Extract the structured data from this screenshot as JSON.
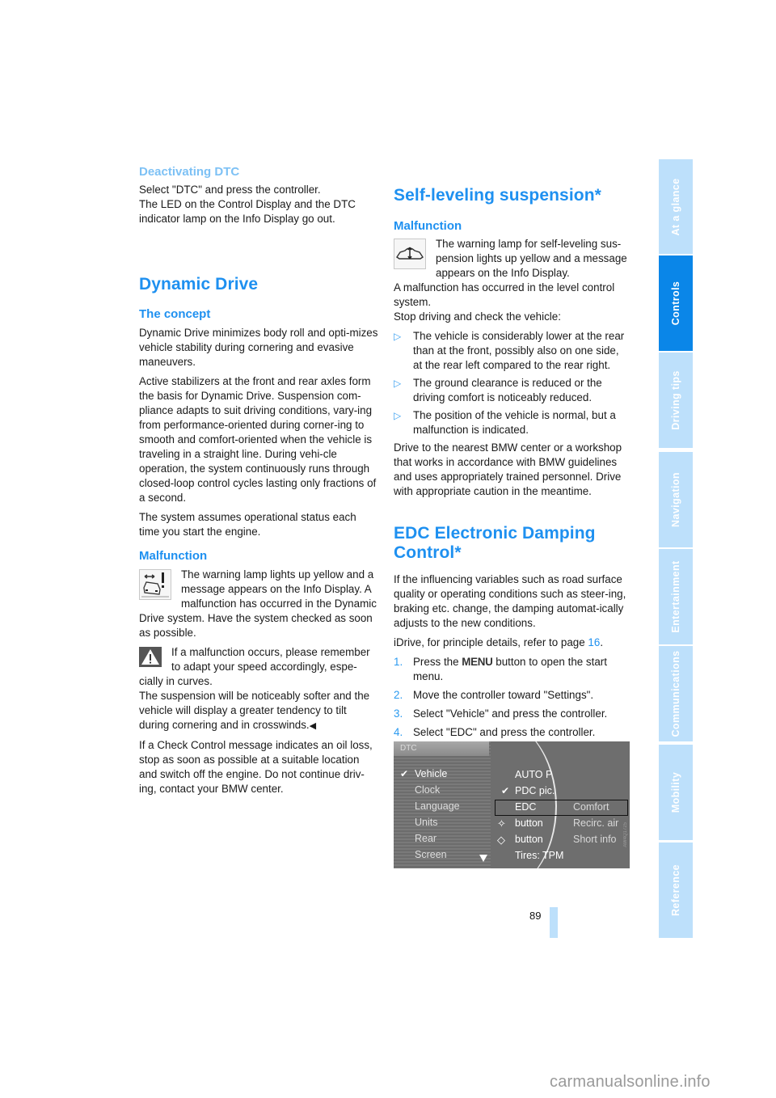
{
  "left_column": {
    "deactivating_dtc": {
      "heading": "Deactivating DTC",
      "text": "Select \"DTC\" and press the controller.\nThe LED on the Control Display and the DTC indicator lamp on the Info Display go out."
    },
    "dynamic_drive": {
      "title": "Dynamic Drive",
      "concept_heading": "The concept",
      "concept_paragraphs": [
        "Dynamic Drive minimizes body roll and opti-mizes vehicle stability during cornering and evasive maneuvers.",
        "Active stabilizers at the front and rear axles form the basis for Dynamic Drive. Suspension com-pliance adapts to suit driving conditions, vary-ing from performance-oriented during corner-ing to smooth and comfort-oriented when the vehicle is traveling in a straight line. During vehi-cle operation, the system continuously runs through closed-loop control cycles lasting only fractions of a second.",
        "The system assumes operational status each time you start the engine."
      ],
      "malfunction_heading": "Malfunction",
      "malfunction_icon": "dynamic-drive-warning-lamp-icon",
      "malfunction_text": "The warning lamp lights up yellow and a message appears on the Info Display. A malfunction has occurred in the Dynamic Drive system. Have the system checked as soon as possible.",
      "caution_icon": "warning-triangle-icon",
      "caution_text": "If a malfunction occurs, please remember to adapt your speed accordingly, espe-cially in curves.",
      "caution_text2": "The suspension will be noticeably softer and the vehicle will display a greater tendency to tilt during cornering and in crosswinds.",
      "end_mark": "◀",
      "oil_loss_text": "If a Check Control message indicates an oil loss, stop as soon as possible at a suitable location and switch off the engine. Do not continue driv-ing, contact your BMW center."
    }
  },
  "right_column": {
    "self_leveling": {
      "title": "Self-leveling suspension*",
      "malfunction_heading": "Malfunction",
      "lamp_icon": "self-leveling-warning-lamp-icon",
      "lamp_text": "The warning lamp for self-leveling sus-pension lights up yellow and a message appears on the Info Display.",
      "text2": "A malfunction has occurred in the level control system.",
      "text3": "Stop driving and check the vehicle:",
      "bullet_marker": "▷",
      "bullets": [
        "The vehicle is considerably lower at the rear than at the front, possibly also on one side, at the rear left compared to the rear right.",
        "The ground clearance is reduced or the driving comfort is noticeably reduced.",
        "The position of the vehicle is normal, but a malfunction is indicated."
      ],
      "closing": "Drive to the nearest BMW center or a workshop that works in accordance with BMW guidelines and uses appropriately trained personnel. Drive with appropriate caution in the meantime."
    },
    "edc": {
      "title": "EDC Electronic Damping Control*",
      "intro": "If the influencing variables such as road surface quality or operating conditions such as steer-ing, braking etc. change, the damping automat-ically adjusts to the new conditions.",
      "idrive_prefix": "iDrive, for principle details, refer to page ",
      "idrive_page": "16",
      "idrive_suffix": ".",
      "steps": [
        {
          "num": "1.",
          "pre": "Press the ",
          "key": "MENU",
          "post": " button to open the start menu."
        },
        {
          "num": "2.",
          "pre": "Move the controller toward \"Settings\".",
          "key": "",
          "post": ""
        },
        {
          "num": "3.",
          "pre": "Select \"Vehicle\" and press the controller.",
          "key": "",
          "post": ""
        },
        {
          "num": "4.",
          "pre": "Select \"EDC\" and press the controller.",
          "key": "",
          "post": ""
        }
      ]
    },
    "screen": {
      "header": "DTC",
      "left_menu": [
        "Vehicle",
        "Clock",
        "Language",
        "Units",
        "Rear",
        "Screen"
      ],
      "left_selected": "Vehicle",
      "right_menu": [
        {
          "label": "AUTO P",
          "value": ""
        },
        {
          "label": "PDC pic.",
          "value": "",
          "checked": true
        },
        {
          "label": "EDC",
          "value": "Comfort",
          "highlighted": true
        },
        {
          "label": "button",
          "value": "Recirc. air",
          "glyph": "✧"
        },
        {
          "label": "button",
          "value": "Short info",
          "glyph": "◇"
        },
        {
          "label": "Tires: TPM",
          "value": ""
        }
      ],
      "checkmark": "✔",
      "image_code": "AW4Q1725"
    }
  },
  "side_tabs": [
    {
      "label": "At a glance",
      "active": false
    },
    {
      "label": "Controls",
      "active": true
    },
    {
      "label": "Driving tips",
      "active": false
    },
    {
      "label": "Navigation",
      "active": false
    },
    {
      "label": "Entertainment",
      "active": false
    },
    {
      "label": "Communications",
      "active": false
    },
    {
      "label": "Mobility",
      "active": false
    },
    {
      "label": "Reference",
      "active": false
    }
  ],
  "page_number": "89",
  "watermark": "carmanualsonline.info",
  "colors": {
    "heading_blue": "#1e90f0",
    "tab_active": "#0a86e8",
    "tab_inactive": "#bde0fb"
  }
}
